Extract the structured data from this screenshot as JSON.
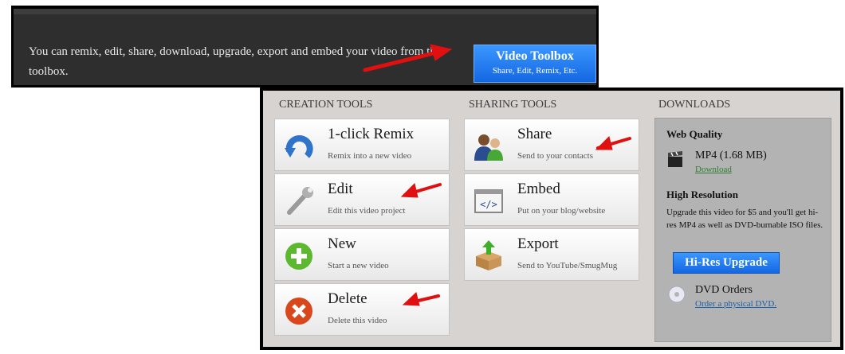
{
  "banner": {
    "text": "You can remix, edit, share, download, upgrade, export and embed your video from the toolbox.",
    "button_title": "Video Toolbox",
    "button_subtitle": "Share, Edit, Remix, Etc."
  },
  "sections": {
    "creation": "CREATION TOOLS",
    "sharing": "SHARING TOOLS",
    "downloads": "DOWNLOADS"
  },
  "creation_tools": [
    {
      "name": "1-click Remix",
      "sub": "Remix into a new video",
      "icon": "remix-icon"
    },
    {
      "name": "Edit",
      "sub": "Edit this video project",
      "icon": "wrench-icon"
    },
    {
      "name": "New",
      "sub": "Start a new video",
      "icon": "plus-icon"
    },
    {
      "name": "Delete",
      "sub": "Delete this video",
      "icon": "delete-icon"
    }
  ],
  "sharing_tools": [
    {
      "name": "Share",
      "sub": "Send to your contacts",
      "icon": "contacts-icon"
    },
    {
      "name": "Embed",
      "sub": "Put on your blog/website",
      "icon": "code-icon"
    },
    {
      "name": "Export",
      "sub": "Send to YouTube/SmugMug",
      "icon": "export-box-icon"
    }
  ],
  "downloads": {
    "web_quality_heading": "Web Quality",
    "mp4_label": "MP4 (1.68 MB)",
    "download_link": "Download",
    "high_res_heading": "High Resolution",
    "upgrade_text": "Upgrade this video for $5 and you'll get hi-res MP4 as well as DVD-burnable ISO files.",
    "hires_button": "Hi-Res Upgrade",
    "dvd_heading": "DVD Orders",
    "dvd_link": "Order a physical DVD."
  },
  "colors": {
    "accent_blue": "#1f7ef5",
    "arrow_red": "#e01010",
    "panel_bg": "#d6d3d1"
  }
}
